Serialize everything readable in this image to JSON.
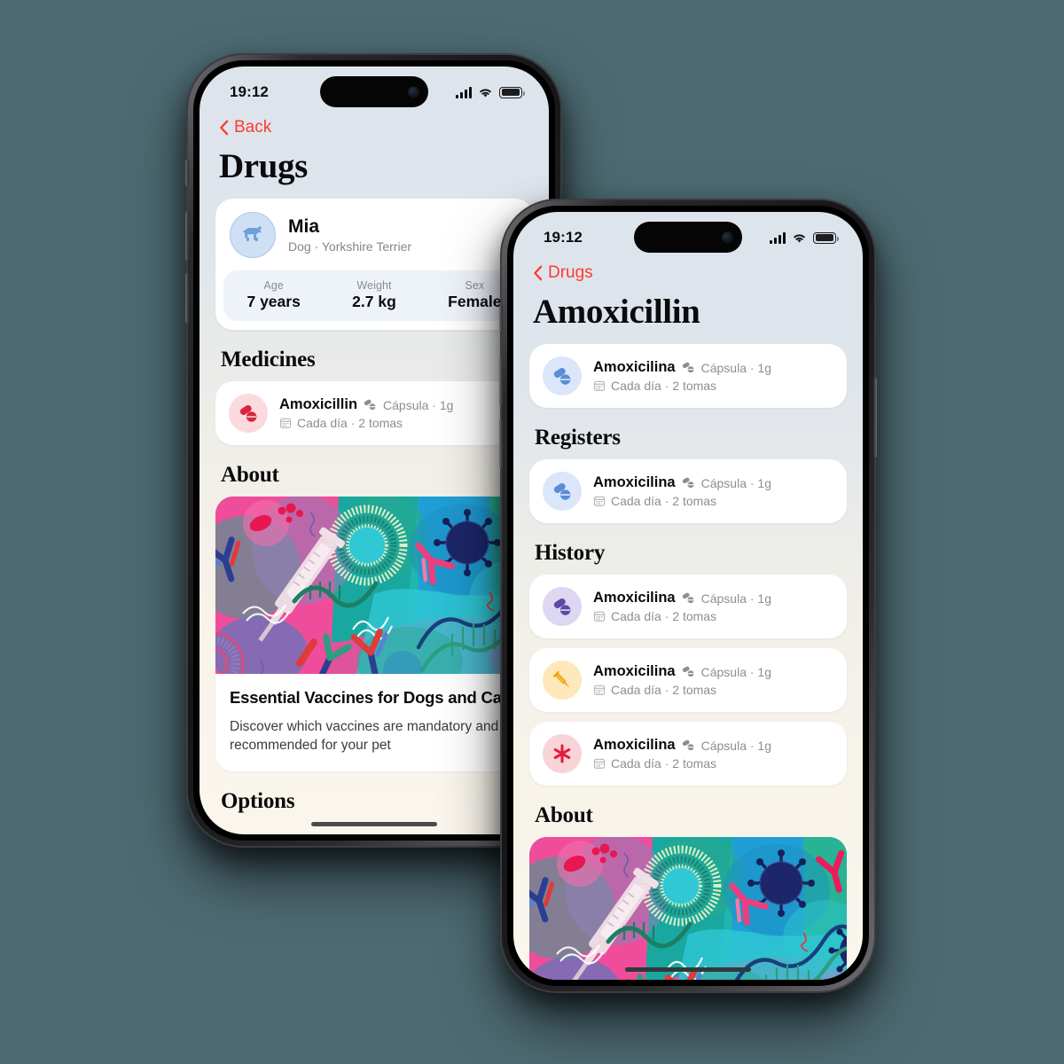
{
  "background_color": "#4d6a72",
  "accent_color": "#ff3b30",
  "phones": {
    "back": {
      "status": {
        "time": "19:12",
        "cellular": "signal-bars",
        "wifi": "wifi",
        "battery": "battery-full"
      },
      "nav_back_label": "Back",
      "title": "Drugs",
      "pet": {
        "name": "Mia",
        "subtitle": "Dog · Yorkshire Terrier",
        "avatar_icon": "dog-icon",
        "stats": [
          {
            "label": "Age",
            "value": "7 years"
          },
          {
            "label": "Weight",
            "value": "2.7 kg"
          },
          {
            "label": "Sex",
            "value": "Female"
          }
        ]
      },
      "medicines_heading": "Medicines",
      "medicines": [
        {
          "name": "Amoxicillin",
          "form": "Cápsula · 1g",
          "frequency": "Cada día · 2 tomas",
          "icon": "pills-icon",
          "icon_bg": "#fadadd",
          "icon_fg": "#d7263d"
        }
      ],
      "about_heading": "About",
      "article": {
        "title": "Essential Vaccines for Dogs and Cats",
        "description": "Discover which vaccines are mandatory and recommended for your pet",
        "image": "vaccine-illustration"
      },
      "options_heading": "Options"
    },
    "front": {
      "status": {
        "time": "19:12",
        "cellular": "signal-bars",
        "wifi": "wifi",
        "battery": "battery-full"
      },
      "nav_back_label": "Drugs",
      "title": "Amoxicillin",
      "summary": [
        {
          "name": "Amoxicilina",
          "form": "Cápsula · 1g",
          "frequency": "Cada día · 2 tomas",
          "icon": "pills-icon",
          "icon_bg": "#dbe6fa",
          "icon_fg": "#5b8cd8"
        }
      ],
      "registers_heading": "Registers",
      "registers": [
        {
          "name": "Amoxicilina",
          "form": "Cápsula · 1g",
          "frequency": "Cada día · 2 tomas",
          "icon": "pills-icon",
          "icon_bg": "#dbe6fa",
          "icon_fg": "#5b8cd8"
        }
      ],
      "history_heading": "History",
      "history": [
        {
          "name": "Amoxicilina",
          "form": "Cápsula · 1g",
          "frequency": "Cada día · 2 tomas",
          "icon": "pills-icon",
          "icon_bg": "#ddd7f2",
          "icon_fg": "#5b4aa5"
        },
        {
          "name": "Amoxicilina",
          "form": "Cápsula · 1g",
          "frequency": "Cada día · 2 tomas",
          "icon": "syringe-icon",
          "icon_bg": "#fde8bb",
          "icon_fg": "#f2a50c"
        },
        {
          "name": "Amoxicilina",
          "form": "Cápsula · 1g",
          "frequency": "Cada día · 2 tomas",
          "icon": "asterisk-icon",
          "icon_bg": "#f8d3d8",
          "icon_fg": "#e6193c"
        }
      ],
      "about_heading": "About",
      "article": {
        "image": "vaccine-illustration"
      }
    }
  }
}
